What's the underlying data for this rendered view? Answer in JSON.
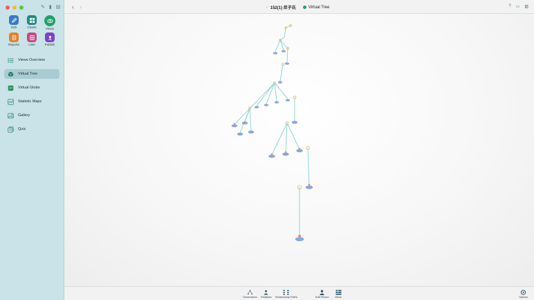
{
  "sidebar": {
    "tools": [
      {
        "label": "Edit",
        "icon": "pencil-icon",
        "color": "#3c7ac7"
      },
      {
        "label": "Charts",
        "icon": "grid-icon",
        "color": "#1a8c7f"
      },
      {
        "label": "Views",
        "icon": "eye-icon",
        "color": "#22a06b"
      },
      {
        "label": "Reports",
        "icon": "report-icon",
        "color": "#e1822b"
      },
      {
        "label": "Lists",
        "icon": "list-icon",
        "color": "#c44a87"
      },
      {
        "label": "Publish",
        "icon": "upload-icon",
        "color": "#7d42c2"
      }
    ],
    "nav": [
      {
        "label": "Views Overview",
        "icon": "grid-list-icon"
      },
      {
        "label": "Virtual Tree",
        "icon": "cube-icon"
      },
      {
        "label": "Virtual Globe",
        "icon": "globe-icon"
      },
      {
        "label": "Statistic Maps",
        "icon": "map-icon"
      },
      {
        "label": "Gallery",
        "icon": "photo-icon"
      },
      {
        "label": "Quiz",
        "icon": "quiz-icon"
      }
    ]
  },
  "titlebar": {
    "back": "‹",
    "forward": "›",
    "person_prefix": "♀",
    "person": "152(1) 尼子氏",
    "view": "Virtual Tree",
    "help": "?"
  },
  "bottombar": {
    "items": [
      {
        "label": "Generations",
        "icon": "generations-icon"
      },
      {
        "label": "Relatives",
        "icon": "relatives-icon"
      },
      {
        "label": "Relationship Paths",
        "icon": "paths-icon"
      },
      {
        "label": "Edit Person",
        "icon": "person-icon"
      },
      {
        "label": "Views",
        "icon": "views-icon"
      },
      {
        "label": "Options",
        "icon": "options-icon"
      }
    ]
  },
  "colors": {
    "accent": "#22a06b",
    "edge": "#7fd3d3",
    "node_male": "#8aa8e0",
    "node_female": "#e48a8a",
    "ring": "#e3c07a"
  }
}
